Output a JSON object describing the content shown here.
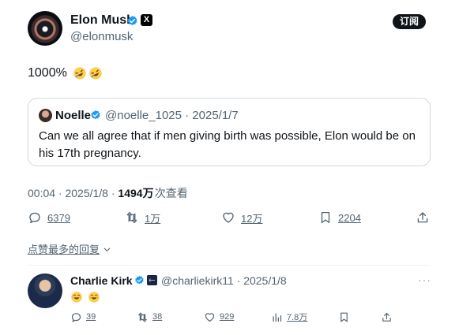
{
  "tweet": {
    "author_name": "Elon Musk",
    "author_handle": "@elonmusk",
    "subscribe_label": "订阅",
    "text": "1000%",
    "emojis": [
      "rofl-emoji",
      "rofl-emoji"
    ],
    "timestamp": "00:04 · 2025/1/8 · ",
    "views_count": "1494万",
    "views_label": "次查看",
    "actions": {
      "replies": "6379",
      "retweets": "1万",
      "likes": "12万",
      "bookmarks": "2204"
    }
  },
  "quote": {
    "author_name": "Noelle",
    "author_handle": "@noelle_1025 · 2025/1/7",
    "text": "Can we all agree that if men giving birth was possible, Elon would be on his 17th pregnancy."
  },
  "sort": {
    "label": "点赞最多的回复"
  },
  "reply": {
    "author_name": "Charlie Kirk",
    "author_handle": "@charliekirk11 · 2025/1/8",
    "more": "···",
    "emojis": [
      "joy-emoji",
      "joy-emoji"
    ],
    "actions": {
      "replies": "39",
      "retweets": "38",
      "likes": "929",
      "views": "7.8万"
    }
  },
  "colors": {
    "verified_blue": "#1d9bf0",
    "text_primary": "#0f1419",
    "text_secondary": "#536471",
    "border": "#cfd9de"
  }
}
